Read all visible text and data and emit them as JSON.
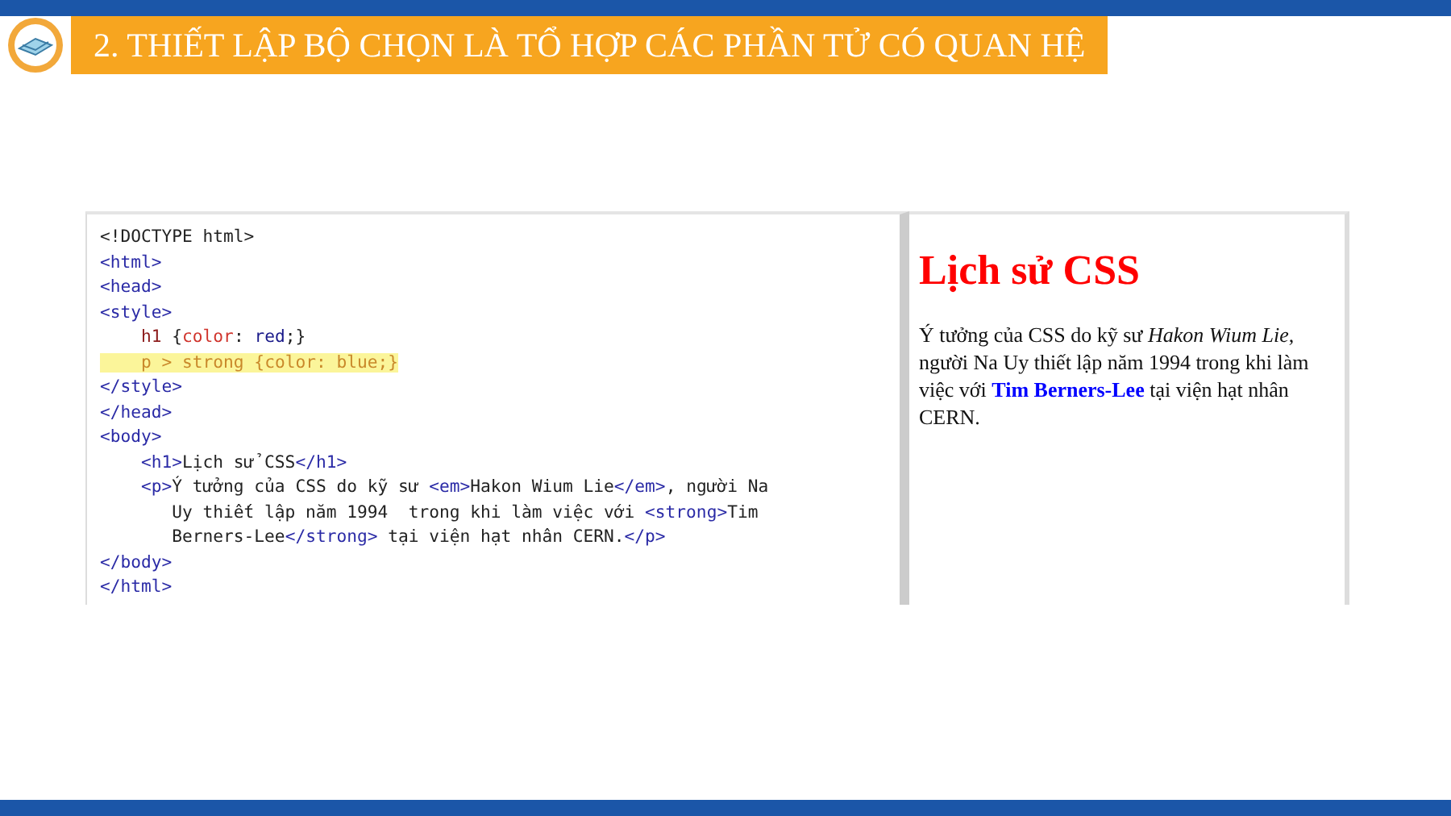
{
  "header": {
    "title": "2. THIẾT LẬP BỘ CHỌN LÀ TỔ HỢP CÁC PHẦN TỬ CÓ QUAN HỆ"
  },
  "code": {
    "lines": [
      {
        "highlighted": false,
        "tokens": [
          {
            "kind": "plain",
            "text": "<!DOCTYPE html>"
          }
        ]
      },
      {
        "highlighted": false,
        "tokens": [
          {
            "kind": "tag",
            "text": "<html>"
          }
        ]
      },
      {
        "highlighted": false,
        "tokens": [
          {
            "kind": "tag",
            "text": "<head>"
          }
        ]
      },
      {
        "highlighted": false,
        "tokens": [
          {
            "kind": "tag",
            "text": "<style>"
          }
        ]
      },
      {
        "highlighted": false,
        "tokens": [
          {
            "kind": "selector",
            "text": "    h1 "
          },
          {
            "kind": "plain",
            "text": "{"
          },
          {
            "kind": "prop",
            "text": "color"
          },
          {
            "kind": "plain",
            "text": ": "
          },
          {
            "kind": "value",
            "text": "red"
          },
          {
            "kind": "plain",
            "text": ";}"
          }
        ]
      },
      {
        "highlighted": true,
        "tokens": [
          {
            "kind": "selector",
            "text": "    p > strong "
          },
          {
            "kind": "plain",
            "text": "{"
          },
          {
            "kind": "prop",
            "text": "color"
          },
          {
            "kind": "plain",
            "text": ": "
          },
          {
            "kind": "value",
            "text": "blue"
          },
          {
            "kind": "plain",
            "text": ";}"
          }
        ]
      },
      {
        "highlighted": false,
        "tokens": [
          {
            "kind": "tag",
            "text": "</style>"
          }
        ]
      },
      {
        "highlighted": false,
        "tokens": [
          {
            "kind": "tag",
            "text": "</head>"
          }
        ]
      },
      {
        "highlighted": false,
        "tokens": [
          {
            "kind": "tag",
            "text": "<body>"
          }
        ]
      },
      {
        "highlighted": false,
        "tokens": [
          {
            "kind": "tag",
            "text": "    <h1>"
          },
          {
            "kind": "plain",
            "text": "Lịch sử CSS"
          },
          {
            "kind": "tag",
            "text": "</h1>"
          }
        ]
      },
      {
        "highlighted": false,
        "tokens": [
          {
            "kind": "tag",
            "text": "    <p>"
          },
          {
            "kind": "plain",
            "text": "Ý tưởng của CSS do kỹ sư "
          },
          {
            "kind": "tag",
            "text": "<em>"
          },
          {
            "kind": "plain",
            "text": "Hakon Wium Lie"
          },
          {
            "kind": "tag",
            "text": "</em>"
          },
          {
            "kind": "plain",
            "text": ", người Na"
          }
        ]
      },
      {
        "highlighted": false,
        "tokens": [
          {
            "kind": "plain",
            "text": "       Uy thiết lập năm 1994  trong khi làm việc với "
          },
          {
            "kind": "tag",
            "text": "<strong>"
          },
          {
            "kind": "plain",
            "text": "Tim"
          }
        ]
      },
      {
        "highlighted": false,
        "tokens": [
          {
            "kind": "plain",
            "text": "       Berners-Lee"
          },
          {
            "kind": "tag",
            "text": "</strong>"
          },
          {
            "kind": "plain",
            "text": " tại viện hạt nhân CERN."
          },
          {
            "kind": "tag",
            "text": "</p>"
          }
        ]
      },
      {
        "highlighted": false,
        "tokens": [
          {
            "kind": "tag",
            "text": "</body>"
          }
        ]
      },
      {
        "highlighted": false,
        "tokens": [
          {
            "kind": "tag",
            "text": "</html>"
          }
        ]
      }
    ]
  },
  "preview": {
    "heading": "Lịch sử CSS",
    "paragraph": "Ý tưởng của CSS do kỹ sư *Hakon Wium Lie*, người Na Uy thiết lập năm 1994 trong khi làm việc với **Tim Berners-Lee** tại viện hạt nhân CERN."
  }
}
